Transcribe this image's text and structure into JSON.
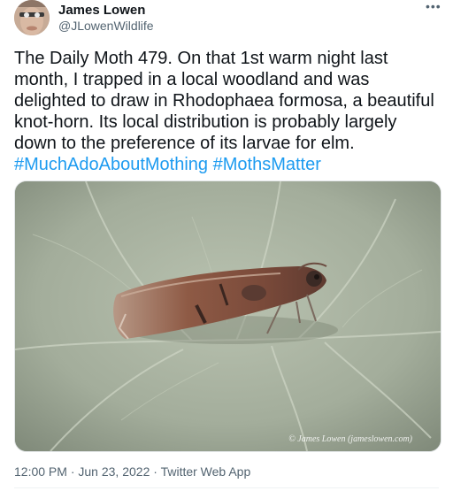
{
  "author": {
    "name": "James Lowen",
    "handle": "@JLowenWildlife"
  },
  "more_icon": "more-horizontal-icon",
  "tweet": {
    "text_main": "The Daily Moth 479. On that 1st warm night last month, I trapped in a local woodland and was delighted to draw in Rhodophaea formosa, a beautiful knot-horn. Its local distribution is probably largely down to the preference of its larvae for elm.",
    "hashtag_1": "#MuchAdoAboutMothing",
    "hashtag_2": "#MothsMatter"
  },
  "media": {
    "credit": "© James Lowen (jameslowen.com)"
  },
  "meta": {
    "time": "12:00 PM",
    "sep1": " · ",
    "date": "Jun 23, 2022",
    "sep2": " · ",
    "source": "Twitter Web App"
  },
  "colors": {
    "link": "#1d9bf0",
    "muted": "#536471",
    "text": "#0f1419"
  }
}
